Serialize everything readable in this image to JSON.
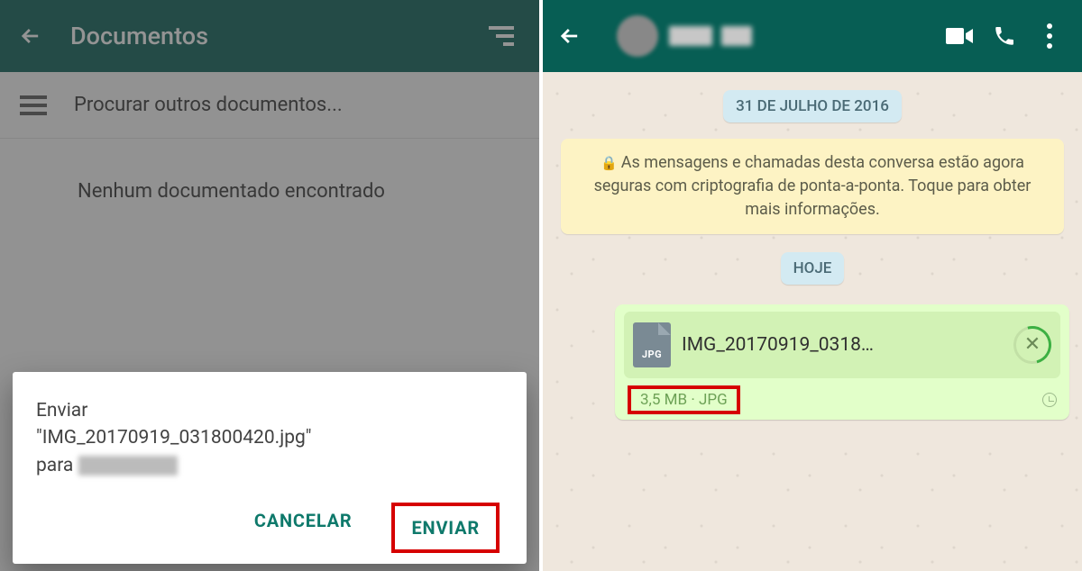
{
  "left": {
    "title": "Documentos",
    "search_row": "Procurar outros documentos...",
    "empty": "Nenhum documentado encontrado",
    "dialog": {
      "line1": "Enviar",
      "line2": "\"IMG_20170919_031800420.jpg\"",
      "line3_prefix": "para ",
      "cancel": "CANCELAR",
      "send": "ENVIAR"
    }
  },
  "right": {
    "date_chip": "31 DE JULHO DE 2016",
    "encryption_notice": "As mensagens e chamadas desta conversa estão agora seguras com criptografia de ponta-a-ponta. Toque para obter mais informações.",
    "today_chip": "HOJE",
    "file": {
      "name": "IMG_20170919_0318…",
      "icon_label": "JPG",
      "meta": "3,5 MB · JPG"
    }
  }
}
